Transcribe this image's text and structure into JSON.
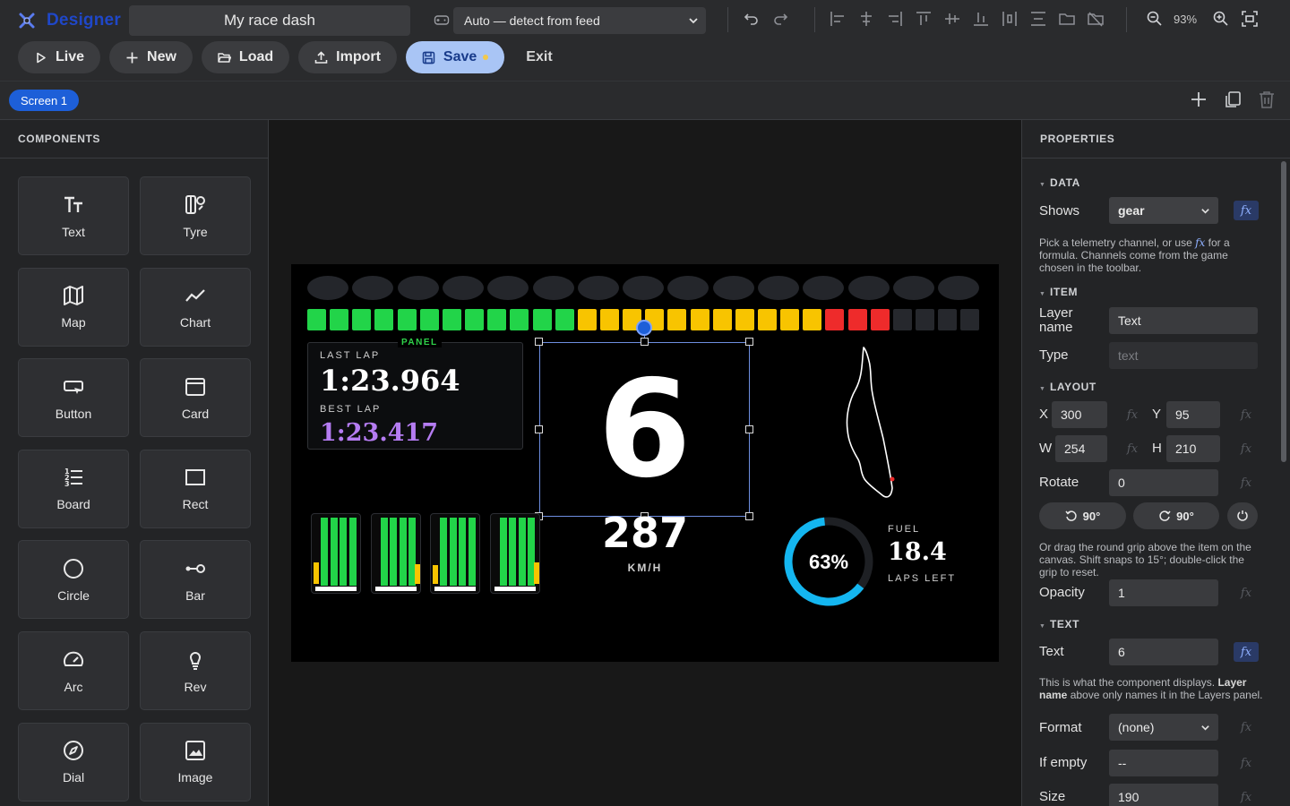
{
  "app": {
    "name": "Designer",
    "dash_title": "My race dash"
  },
  "toolbar": {
    "feed_select": "Auto — detect from feed",
    "zoom_label": "93%",
    "buttons": {
      "live": "Live",
      "new": "New",
      "load": "Load",
      "import": "Import",
      "save": "Save",
      "exit": "Exit"
    }
  },
  "screens": {
    "active_tab": "Screen 1"
  },
  "components_panel": {
    "title": "COMPONENTS",
    "items": [
      {
        "label": "Text",
        "icon": "text-icon"
      },
      {
        "label": "Tyre",
        "icon": "tyre-icon"
      },
      {
        "label": "Map",
        "icon": "map-icon"
      },
      {
        "label": "Chart",
        "icon": "chart-icon"
      },
      {
        "label": "Button",
        "icon": "button-icon"
      },
      {
        "label": "Card",
        "icon": "card-icon"
      },
      {
        "label": "Board",
        "icon": "board-icon"
      },
      {
        "label": "Rect",
        "icon": "rect-icon"
      },
      {
        "label": "Circle",
        "icon": "circle-icon"
      },
      {
        "label": "Bar",
        "icon": "bar-icon"
      },
      {
        "label": "Arc",
        "icon": "arc-icon"
      },
      {
        "label": "Rev",
        "icon": "rev-icon"
      },
      {
        "label": "Dial",
        "icon": "dial-icon"
      },
      {
        "label": "Image",
        "icon": "image-icon"
      }
    ]
  },
  "dash": {
    "panel_tag": "PANEL",
    "last_lap_label": "LAST LAP",
    "last_lap": "1:23.964",
    "best_lap_label": "BEST LAP",
    "best_lap": "1:23.417",
    "gear": "6",
    "speed": "287",
    "speed_unit": "KM/H",
    "fuel_label": "FUEL",
    "fuel_value": "18.4",
    "fuel_sub": "LAPS LEFT",
    "fuel_percent_text": "63%",
    "fuel_fraction": 0.63,
    "shift_lights_count": 15,
    "rev_segments": {
      "green": 12,
      "yellow": 11,
      "red": 3,
      "off": 4
    },
    "tyre_levels": [
      0.3,
      0.28,
      0.26,
      0.3
    ],
    "colors": {
      "green": "#22d449",
      "yellow": "#f8c400",
      "red": "#ee2b2b",
      "off": "#26282d",
      "purple": "#b57cf2",
      "ring": "#14b6f0"
    }
  },
  "properties": {
    "title": "PROPERTIES",
    "data": {
      "header": "DATA",
      "shows_label": "Shows",
      "shows_value": "gear",
      "help_a": "Pick a telemetry channel, or use",
      "help_fx": "fx",
      "help_b": "for a formula. Channels come from the game chosen in the toolbar."
    },
    "item": {
      "header": "ITEM",
      "layer_name_label": "Layer name",
      "layer_name_value": "Text",
      "type_label": "Type",
      "type_value": "text"
    },
    "layout": {
      "header": "LAYOUT",
      "x_label": "X",
      "x_value": "300",
      "y_label": "Y",
      "y_value": "95",
      "w_label": "W",
      "w_value": "254",
      "h_label": "H",
      "h_value": "210",
      "rotate_label": "Rotate",
      "rotate_value": "0",
      "rot_left": "90°",
      "rot_right": "90°",
      "rotate_help": "Or drag the round grip above the item on the canvas. Shift snaps to 15°; double-click the grip to reset.",
      "opacity_label": "Opacity",
      "opacity_value": "1"
    },
    "text": {
      "header": "TEXT",
      "text_label": "Text",
      "text_value": "6",
      "help_a": "This is what the component displays.",
      "help_bold_a": "Layer",
      "help_bold_b": "name",
      "help_b": "above only names it in the Layers panel.",
      "format_label": "Format",
      "format_value": "(none)",
      "if_empty_label": "If empty",
      "if_empty_value": "--",
      "size_label": "Size",
      "size_value": "190"
    }
  }
}
